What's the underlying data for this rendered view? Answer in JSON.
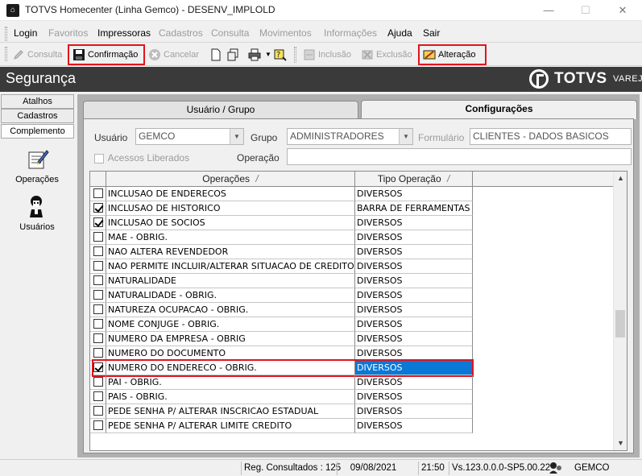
{
  "window": {
    "title": "TOTVS Homecenter (Linha Gemco) - DESENV_IMPLOLD",
    "minimize": "—",
    "maximize": "☐",
    "close": "✕"
  },
  "menu": [
    {
      "label": "Login",
      "enabled": true
    },
    {
      "label": "Favoritos",
      "enabled": false
    },
    {
      "label": "Impressoras",
      "enabled": true
    },
    {
      "label": "Cadastros",
      "enabled": false
    },
    {
      "label": "Consulta",
      "enabled": false
    },
    {
      "label": "Movimentos",
      "enabled": false
    },
    {
      "label": "Informações",
      "enabled": false
    },
    {
      "label": "Ajuda",
      "enabled": true
    },
    {
      "label": "Sair",
      "enabled": true
    }
  ],
  "toolbar": {
    "consulta": "Consulta",
    "confirmacao": "Confirmação",
    "cancelar": "Cancelar",
    "inclusao": "Inclusão",
    "exclusao": "Exclusão",
    "alteracao": "Alteração"
  },
  "banner": {
    "title": "Segurança",
    "brand": "TOTVS",
    "brand_sub": "VAREJO"
  },
  "leftnav": {
    "tabs": [
      "Atalhos",
      "Cadastros",
      "Complemento"
    ],
    "entries": [
      {
        "label": "Operações",
        "icon": "operations-icon"
      },
      {
        "label": "Usuários",
        "icon": "users-icon"
      }
    ]
  },
  "tabs": {
    "usuario_grupo": "Usuário  / Grupo",
    "configuracoes": "Configurações"
  },
  "form": {
    "usuario_label": "Usuário",
    "usuario_value": "GEMCO",
    "grupo_label": "Grupo",
    "grupo_value": "ADMINISTRADORES",
    "formulario_label": "Formulário",
    "formulario_value": "CLIENTES - DADOS BASICOS",
    "acessos_label": "Acessos Liberados",
    "operacao_label": "Operação",
    "operacao_value": ""
  },
  "grid": {
    "columns": [
      "Operações",
      "Tipo Operação"
    ],
    "sort_mark": "/",
    "rows": [
      {
        "checked": false,
        "operacao": "INCLUSAO DE ENDERECOS",
        "tipo": "DIVERSOS"
      },
      {
        "checked": true,
        "operacao": "INCLUSAO DE HISTORICO",
        "tipo": "BARRA DE FERRAMENTAS"
      },
      {
        "checked": true,
        "operacao": "INCLUSAO DE SOCIOS",
        "tipo": "DIVERSOS"
      },
      {
        "checked": false,
        "operacao": "MAE - OBRIG.",
        "tipo": "DIVERSOS"
      },
      {
        "checked": false,
        "operacao": "NAO ALTERA REVENDEDOR",
        "tipo": "DIVERSOS"
      },
      {
        "checked": false,
        "operacao": "NAO PERMITE INCLUIR/ALTERAR SITUACAO DE CREDITO",
        "tipo": "DIVERSOS"
      },
      {
        "checked": false,
        "operacao": "NATURALIDADE",
        "tipo": "DIVERSOS"
      },
      {
        "checked": false,
        "operacao": "NATURALIDADE - OBRIG.",
        "tipo": "DIVERSOS"
      },
      {
        "checked": false,
        "operacao": "NATUREZA OCUPACAO - OBRIG.",
        "tipo": "DIVERSOS"
      },
      {
        "checked": false,
        "operacao": "NOME CONJUGE - OBRIG.",
        "tipo": "DIVERSOS"
      },
      {
        "checked": false,
        "operacao": "NUMERO DA EMPRESA - OBRIG",
        "tipo": "DIVERSOS"
      },
      {
        "checked": false,
        "operacao": "NUMERO DO DOCUMENTO",
        "tipo": "DIVERSOS"
      },
      {
        "checked": true,
        "operacao": "NUMERO DO ENDERECO - OBRIG.",
        "tipo": "DIVERSOS",
        "selected": true
      },
      {
        "checked": false,
        "operacao": "PAI - OBRIG.",
        "tipo": "DIVERSOS"
      },
      {
        "checked": false,
        "operacao": "PAIS - OBRIG.",
        "tipo": "DIVERSOS"
      },
      {
        "checked": false,
        "operacao": "PEDE SENHA P/ ALTERAR INSCRICAO ESTADUAL",
        "tipo": "DIVERSOS"
      },
      {
        "checked": false,
        "operacao": "PEDE SENHA P/ ALTERAR LIMITE CREDITO",
        "tipo": "DIVERSOS"
      }
    ]
  },
  "status": {
    "registros": "Reg. Consultados : 125",
    "data": "09/08/2021",
    "hora": "21:50",
    "versao": "Vs.123.0.0.0-SP5.00.22",
    "usuario": "GEMCO"
  },
  "colors": {
    "highlight": "#e0141e",
    "selection": "#0a78d7",
    "banner": "#3a3a3a"
  }
}
